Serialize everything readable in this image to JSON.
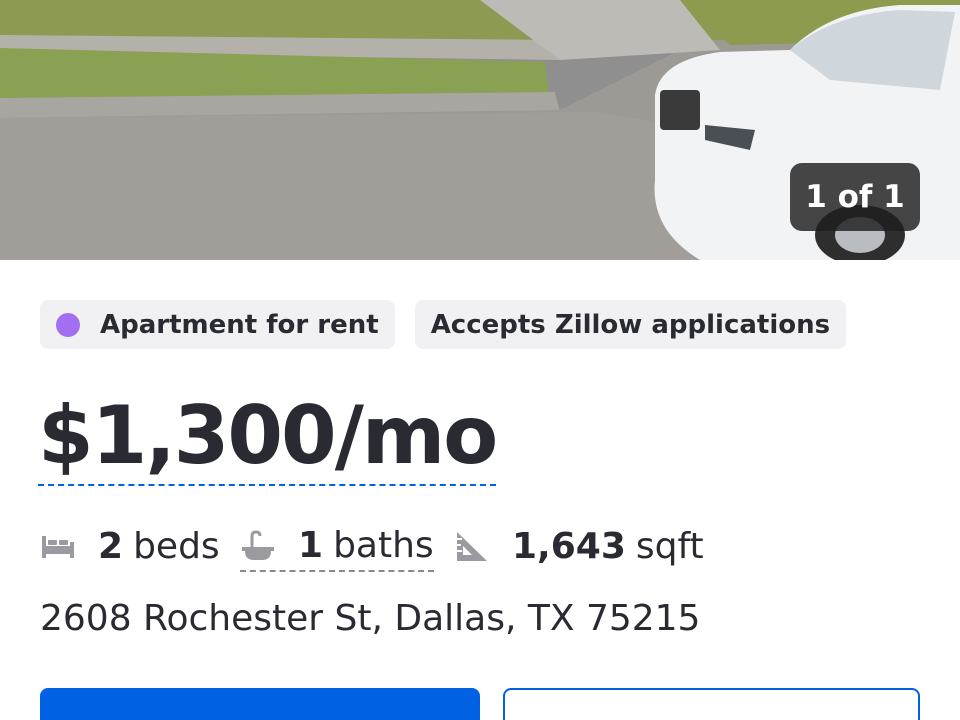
{
  "photo": {
    "counter_text": "1 of 1"
  },
  "chips": {
    "status_label": "Apartment for rent",
    "status_color": "#a46ef2",
    "application_label": "Accepts Zillow applications"
  },
  "price": "$1,300/mo",
  "facts": {
    "beds_value": "2",
    "beds_unit": "beds",
    "baths_value": "1",
    "baths_unit": "baths",
    "sqft_value": "1,643",
    "sqft_unit": "sqft"
  },
  "address": "2608 Rochester St, Dallas, TX 75215",
  "buttons": {
    "primary_label": "",
    "secondary_label": ""
  },
  "colors": {
    "accent": "#0062e3",
    "text": "#2a2a33",
    "chip_bg": "#f1f1f4"
  },
  "icons": [
    "bed-icon",
    "bathtub-icon",
    "ruler-triangle-icon"
  ]
}
